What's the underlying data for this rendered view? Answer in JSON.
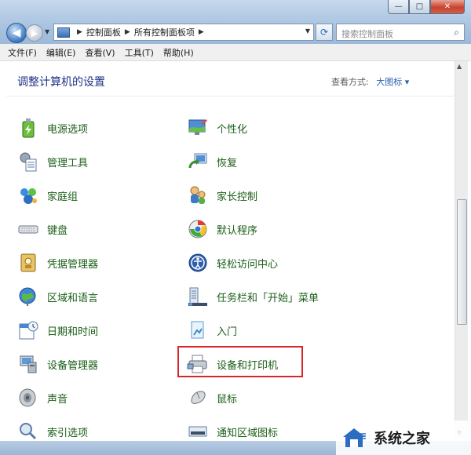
{
  "window": {
    "controls": {
      "minimize": "—",
      "maximize": "□",
      "close": "✕"
    }
  },
  "address": {
    "segments": [
      "控制面板",
      "所有控制面板项"
    ],
    "search_placeholder": "搜索控制面板"
  },
  "menu": [
    "文件(F)",
    "编辑(E)",
    "查看(V)",
    "工具(T)",
    "帮助(H)"
  ],
  "content": {
    "title": "调整计算机的设置",
    "view_by_label": "查看方式:",
    "view_by_value": "大图标 ▾"
  },
  "items_left": [
    {
      "label": "电源选项",
      "icon": "power-options-icon"
    },
    {
      "label": "管理工具",
      "icon": "admin-tools-icon"
    },
    {
      "label": "家庭组",
      "icon": "homegroup-icon"
    },
    {
      "label": "键盘",
      "icon": "keyboard-icon"
    },
    {
      "label": "凭据管理器",
      "icon": "credential-manager-icon"
    },
    {
      "label": "区域和语言",
      "icon": "region-language-icon"
    },
    {
      "label": "日期和时间",
      "icon": "date-time-icon"
    },
    {
      "label": "设备管理器",
      "icon": "device-manager-icon"
    },
    {
      "label": "声音",
      "icon": "sound-icon"
    },
    {
      "label": "索引选项",
      "icon": "indexing-options-icon"
    }
  ],
  "items_right": [
    {
      "label": "个性化",
      "icon": "personalization-icon"
    },
    {
      "label": "恢复",
      "icon": "recovery-icon"
    },
    {
      "label": "家长控制",
      "icon": "parental-controls-icon"
    },
    {
      "label": "默认程序",
      "icon": "default-programs-icon"
    },
    {
      "label": "轻松访问中心",
      "icon": "ease-of-access-icon"
    },
    {
      "label": "任务栏和「开始」菜单",
      "icon": "taskbar-start-menu-icon"
    },
    {
      "label": "入门",
      "icon": "getting-started-icon"
    },
    {
      "label": "设备和打印机",
      "icon": "devices-printers-icon"
    },
    {
      "label": "鼠标",
      "icon": "mouse-icon"
    },
    {
      "label": "通知区域图标",
      "icon": "notification-area-icon"
    }
  ],
  "watermark": {
    "text": "系统之家"
  },
  "colors": {
    "link_green": "#1a5e16",
    "title_blue": "#1e3287",
    "highlight_red": "#d8262b"
  }
}
